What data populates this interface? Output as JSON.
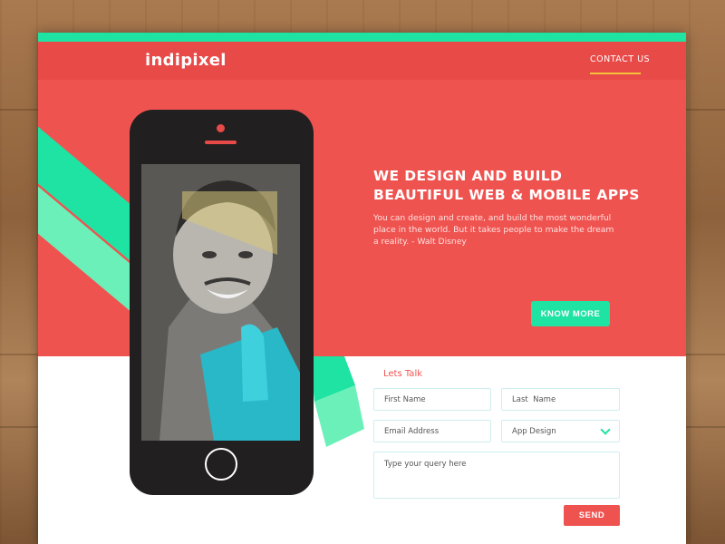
{
  "brand": {
    "name": "indipixel"
  },
  "nav": {
    "contact_label": "CONTACT US"
  },
  "hero": {
    "headline_line1": "WE DESIGN AND BUILD",
    "headline_line2": "BEAUTIFUL WEB & MOBILE APPS",
    "quote": "You can design and create, and build the most wonderful place in the world. But it takes people to make the dream a reality. - Walt Disney",
    "cta_label": "KNOW MORE"
  },
  "form": {
    "title": "Lets Talk",
    "first_name_placeholder": "First Name",
    "last_name_placeholder": "Last  Name",
    "email_placeholder": "Email Address",
    "service_selected": "App Design",
    "query_placeholder": "Type your query here",
    "send_label": "SEND"
  },
  "colors": {
    "brand_red": "#ef5350",
    "accent_green": "#1ee3a3",
    "light_green": "#6bf0b9",
    "underline_yellow": "#f5c23b"
  },
  "icons": [
    "chevron-down-icon",
    "home-button-icon",
    "speaker-icon",
    "camera-icon"
  ]
}
